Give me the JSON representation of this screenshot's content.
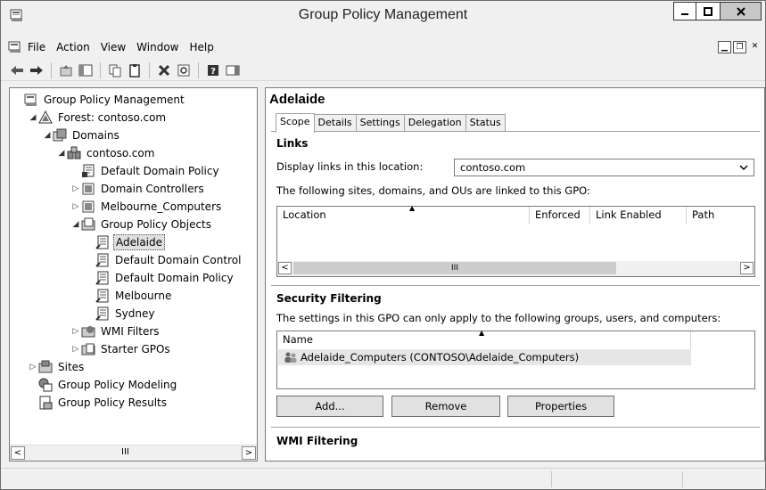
{
  "window": {
    "title": "Group Policy Management"
  },
  "menu": [
    "File",
    "Action",
    "View",
    "Window",
    "Help"
  ],
  "tree": {
    "items": [
      {
        "label": "Group Policy Management",
        "depth": 0,
        "expander": "",
        "icon": "gpm-console-icon",
        "selected": false
      },
      {
        "label": "Forest: contoso.com",
        "depth": 1,
        "expander": "◢",
        "icon": "forest-icon",
        "selected": false
      },
      {
        "label": "Domains",
        "depth": 2,
        "expander": "◢",
        "icon": "domains-icon",
        "selected": false
      },
      {
        "label": "contoso.com",
        "depth": 3,
        "expander": "◢",
        "icon": "domain-icon",
        "selected": false
      },
      {
        "label": "Default Domain Policy",
        "depth": 4,
        "expander": "",
        "icon": "gpo-link-icon",
        "selected": false
      },
      {
        "label": "Domain Controllers",
        "depth": 4,
        "expander": "▷",
        "icon": "ou-icon",
        "selected": false
      },
      {
        "label": "Melbourne_Computers",
        "depth": 4,
        "expander": "▷",
        "icon": "ou-icon",
        "selected": false
      },
      {
        "label": "Group Policy Objects",
        "depth": 4,
        "expander": "◢",
        "icon": "gpo-folder-icon",
        "selected": false
      },
      {
        "label": "Adelaide",
        "depth": 5,
        "expander": "",
        "icon": "gpo-icon",
        "selected": true
      },
      {
        "label": "Default Domain Control",
        "depth": 5,
        "expander": "",
        "icon": "gpo-icon",
        "selected": false
      },
      {
        "label": "Default Domain Policy",
        "depth": 5,
        "expander": "",
        "icon": "gpo-icon",
        "selected": false
      },
      {
        "label": "Melbourne",
        "depth": 5,
        "expander": "",
        "icon": "gpo-icon",
        "selected": false
      },
      {
        "label": "Sydney",
        "depth": 5,
        "expander": "",
        "icon": "gpo-icon",
        "selected": false
      },
      {
        "label": "WMI Filters",
        "depth": 4,
        "expander": "▷",
        "icon": "wmi-folder-icon",
        "selected": false
      },
      {
        "label": "Starter GPOs",
        "depth": 4,
        "expander": "▷",
        "icon": "starter-gpo-folder-icon",
        "selected": false
      },
      {
        "label": "Sites",
        "depth": 1,
        "expander": "▷",
        "icon": "sites-icon",
        "selected": false
      },
      {
        "label": "Group Policy Modeling",
        "depth": 1,
        "expander": "",
        "icon": "modeling-icon",
        "selected": false
      },
      {
        "label": "Group Policy Results",
        "depth": 1,
        "expander": "",
        "icon": "results-icon",
        "selected": false
      }
    ],
    "scroll_thumb": "III"
  },
  "detail": {
    "title": "Adelaide",
    "tabs": [
      "Scope",
      "Details",
      "Settings",
      "Delegation",
      "Status"
    ],
    "active_tab": "Scope",
    "links": {
      "heading": "Links",
      "display_label": "Display links in this location:",
      "location_value": "contoso.com",
      "description": "The following sites, domains, and OUs are linked to this GPO:",
      "columns": [
        "Location",
        "Enforced",
        "Link Enabled",
        "Path"
      ],
      "scroll_thumb": "III"
    },
    "security": {
      "heading": "Security Filtering",
      "description": "The settings in this GPO can only apply to the following groups, users, and computers:",
      "column": "Name",
      "rows": [
        "Adelaide_Computers (CONTOSO\\Adelaide_Computers)"
      ],
      "buttons": {
        "add": "Add...",
        "remove": "Remove",
        "properties": "Properties"
      }
    },
    "wmi": {
      "heading": "WMI Filtering"
    }
  }
}
